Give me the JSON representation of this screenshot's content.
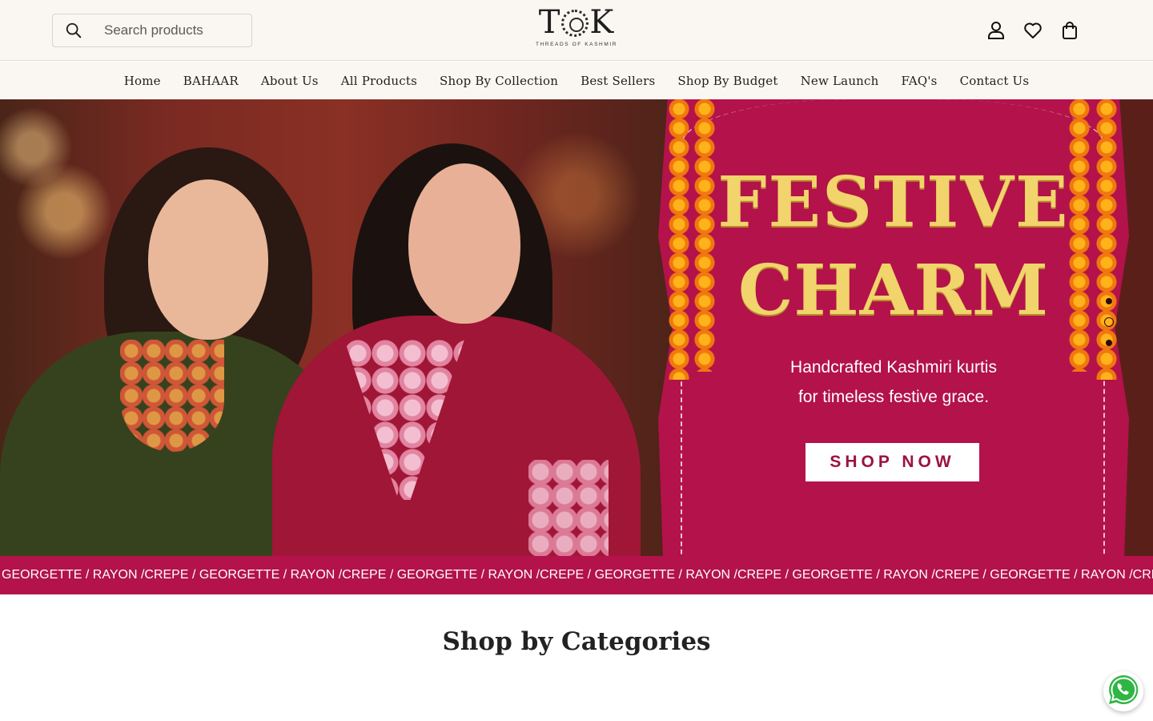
{
  "search": {
    "placeholder": "Search products"
  },
  "brand": {
    "logo_text": "TOK",
    "tagline": "THREADS OF KASHMIR"
  },
  "nav": {
    "items": [
      {
        "label": "Home"
      },
      {
        "label": "BAHAAR"
      },
      {
        "label": "About Us"
      },
      {
        "label": "All Products"
      },
      {
        "label": "Shop By Collection"
      },
      {
        "label": "Best Sellers"
      },
      {
        "label": "Shop By Budget"
      },
      {
        "label": "New Launch"
      },
      {
        "label": "FAQ's"
      },
      {
        "label": "Contact Us"
      }
    ]
  },
  "header_icons": [
    "user-icon",
    "heart-icon",
    "bag-icon"
  ],
  "hero": {
    "title_line1": "FESTIVE",
    "title_line2": "CHARM",
    "subtitle_line1": "Handcrafted Kashmiri kurtis",
    "subtitle_line2": "for timeless festive grace.",
    "cta": "SHOP NOW",
    "slide_count": 3,
    "active_slide": 2
  },
  "ticker": {
    "text": "E / GEORGETTE / RAYON /CREPE / GEORGETTE / RAYON /CREPE / GEORGETTE / RAYON /CREPE / GEORGETTE / RAYON /CREPE / GEORGETTE / RAYON /CREPE / GEORGETTE / RAYON /CREPE"
  },
  "section": {
    "title": "Shop by Categories"
  },
  "colors": {
    "brand_magenta": "#b3124a",
    "gold": "#f1d46b",
    "header_bg": "#faf7f2"
  }
}
